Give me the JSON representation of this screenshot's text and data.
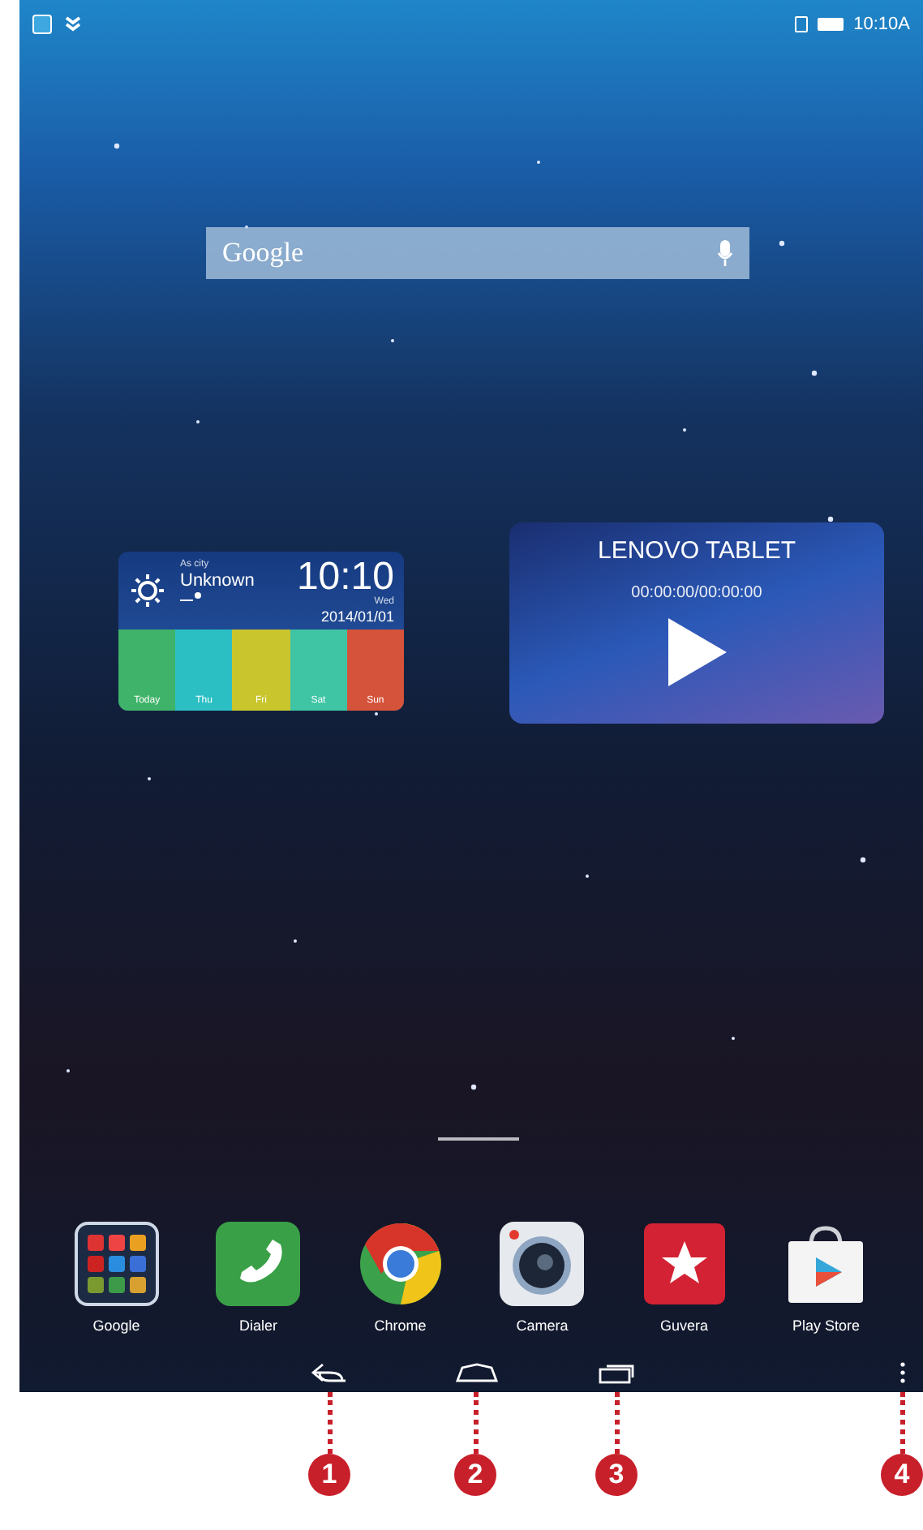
{
  "status_bar": {
    "time": "10:10A"
  },
  "search": {
    "placeholder": "Google"
  },
  "weather": {
    "city_hint": "As city",
    "city": "Unknown",
    "time": "10:10",
    "weekday": "Wed",
    "date": "2014/01/01",
    "days": [
      {
        "label": "Today",
        "color": "#3fb36a"
      },
      {
        "label": "Thu",
        "color": "#2bbfc4"
      },
      {
        "label": "Fri",
        "color": "#c9c52c"
      },
      {
        "label": "Sat",
        "color": "#3fc4a4"
      },
      {
        "label": "Sun",
        "color": "#d5533a"
      }
    ]
  },
  "music": {
    "title": "LENOVO TABLET",
    "time": "00:00:00/00:00:00"
  },
  "dock": [
    {
      "label": "Google",
      "kind": "folder"
    },
    {
      "label": "Dialer",
      "kind": "dialer"
    },
    {
      "label": "Chrome",
      "kind": "chrome"
    },
    {
      "label": "Camera",
      "kind": "camera"
    },
    {
      "label": "Guvera",
      "kind": "guvera"
    },
    {
      "label": "Play Store",
      "kind": "store"
    }
  ],
  "callouts": [
    "1",
    "2",
    "3",
    "4"
  ]
}
